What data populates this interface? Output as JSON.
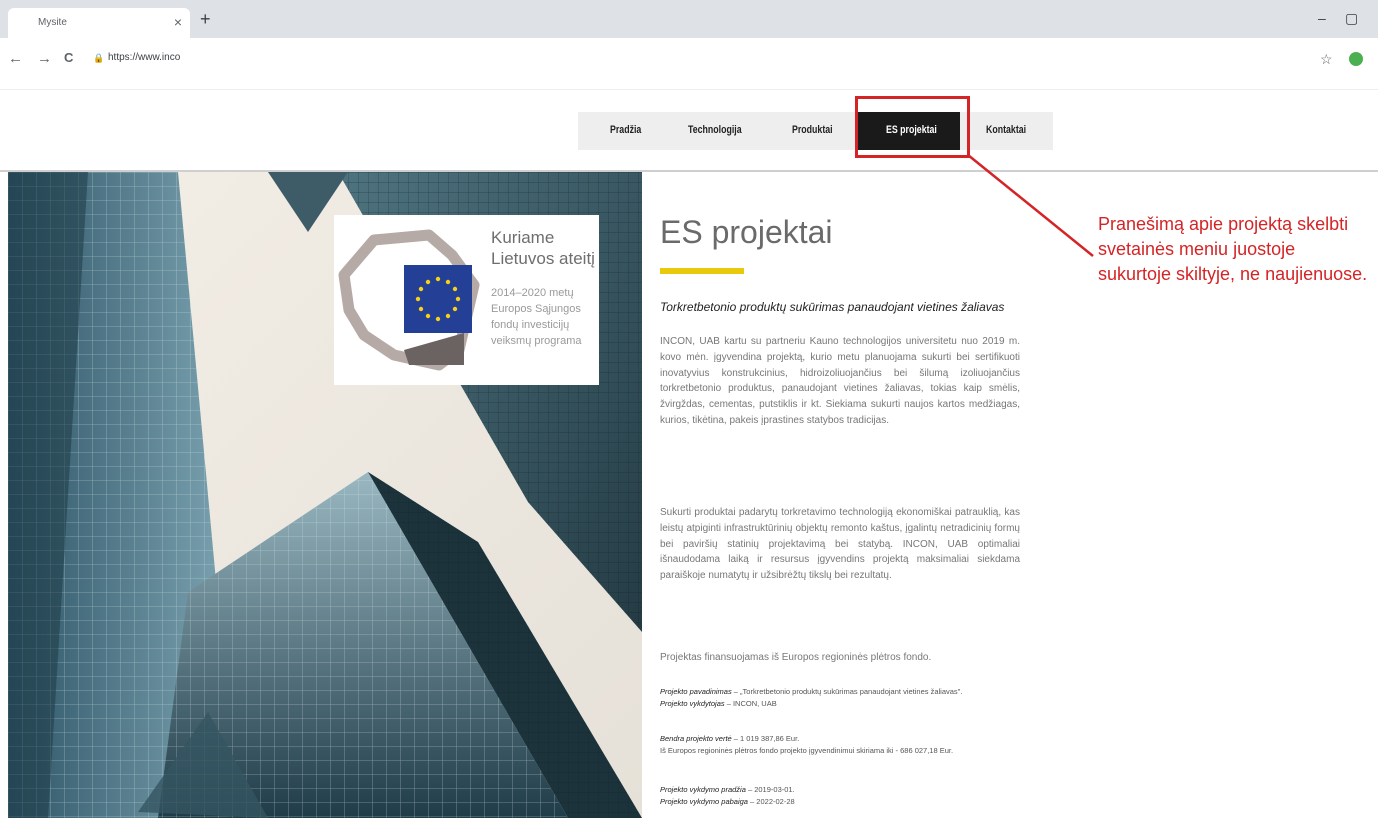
{
  "browser": {
    "tab_title": "Mysite",
    "tab_close": "×",
    "new_tab": "+",
    "url": "https://www.inco",
    "minimize": "–",
    "restore": "▢",
    "back": "←",
    "forward": "→",
    "reload": "C",
    "lock": "🔒",
    "star": "☆"
  },
  "nav": {
    "items": [
      "Pradžia",
      "Technologija",
      "Produktai",
      "ES projektai",
      "Kontaktai"
    ],
    "active_index": 3
  },
  "logo": {
    "title_line1": "Kuriame",
    "title_line2": "Lietuvos ateitį",
    "sub_line1": "2014–2020 metų",
    "sub_line2": "Europos Sąjungos",
    "sub_line3": "fondų investicijų",
    "sub_line4": "veiksmų programa"
  },
  "content": {
    "title": "ES projektai",
    "subtitle": "Torkretbetonio produktų sukūrimas panaudojant vietines žaliavas",
    "paragraph1": "INCON, UAB kartu su partneriu Kauno technologijos universitetu nuo 2019 m. kovo mėn. įgyvendina projektą, kurio metu planuojama sukurti bei sertifikuoti inovatyvius konstrukcinius, hidroizoliuojančius bei šilumą izoliuojančius torkretbetonio produktus, panaudojant vietines žaliavas, tokias kaip smėlis, žvirgždas, cementas, putstiklis ir kt. Siekiama sukurti naujos kartos medžiagas, kurios, tikėtina, pakeis įprastines statybos tradicijas.",
    "paragraph2": "Sukurti produktai padarytų torkretavimo technologiją ekonomiškai patrauklią, kas leistų atpiginti infrastruktūrinių objektų remonto kaštus, įgalintų netradicinių formų bei paviršių statinių projektavimą bei statybą. INCON, UAB optimaliai išnaudodama laiką ir resursus įgyvendins projektą maksimaliai siekdama paraiškoje numatytų ir užsibrėžtų tikslų bei rezultatų.",
    "paragraph3": "Projektas finansuojamas iš Europos regioninės plėtros fondo.",
    "name_label": "Projekto pavadinimas",
    "name_value": " – „Torkretbetonio produktų sukūrimas panaudojant vietines žaliavas\".",
    "executor_label": "Projekto vykdytojas",
    "executor_value": " – INCON, UAB",
    "value_label": "Bendra projekto vertė",
    "value_value": " – 1 019 387,86 Eur.",
    "fund_line": "Iš Europos regioninės plėtros fondo projekto įgyvendinimui skiriama iki - 686 027,18 Eur.",
    "start_label": "Projekto vykdymo pradžia",
    "start_value": " – 2019-03-01.",
    "end_label": "Projekto vykdymo pabaiga",
    "end_value": " – 2022-02-28"
  },
  "annotation": {
    "text": "Pranešimą apie projektą skelbti svetainės meniu juostoje sukurtoje skiltyje, ne naujienuose.",
    "color": "#d42426"
  },
  "colors": {
    "accent_yellow": "#e8c90c",
    "menu_active_bg": "#1a1a1a",
    "highlight_red": "#d42426"
  }
}
